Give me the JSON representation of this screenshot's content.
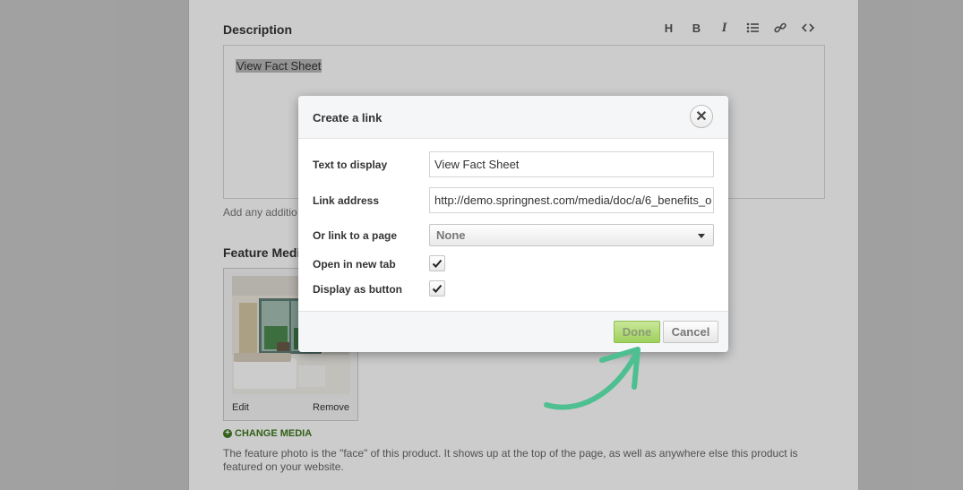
{
  "editor": {
    "description_label": "Description",
    "toolbar": {
      "heading": "H",
      "bold": "B",
      "italic": "I"
    },
    "content_text": "View Fact Sheet",
    "helper_text": "Add any additio"
  },
  "feature_media": {
    "label": "Feature Medi",
    "edit_label": "Edit",
    "remove_label": "Remove",
    "change_media_label": "CHANGE MEDIA",
    "description": "The feature photo is the \"face\" of this product. It shows up at the top of the page, as well as anywhere else this product is featured on your website."
  },
  "modal": {
    "title": "Create a link",
    "close_symbol": "✕",
    "text_to_display_label": "Text to display",
    "text_to_display_value": "View Fact Sheet",
    "link_address_label": "Link address",
    "link_address_value": "http://demo.springnest.com/media/doc/a/6_benefits_o",
    "page_link_label": "Or link to a page",
    "page_link_value": "None",
    "open_new_tab_label": "Open in new tab",
    "open_new_tab_checked": true,
    "display_button_label": "Display as button",
    "display_button_checked": true,
    "done_label": "Done",
    "cancel_label": "Cancel"
  },
  "colors": {
    "accent_green": "#9fd05c",
    "annotation_arrow": "#4dbf91",
    "change_media_green": "#3f7a1e"
  }
}
